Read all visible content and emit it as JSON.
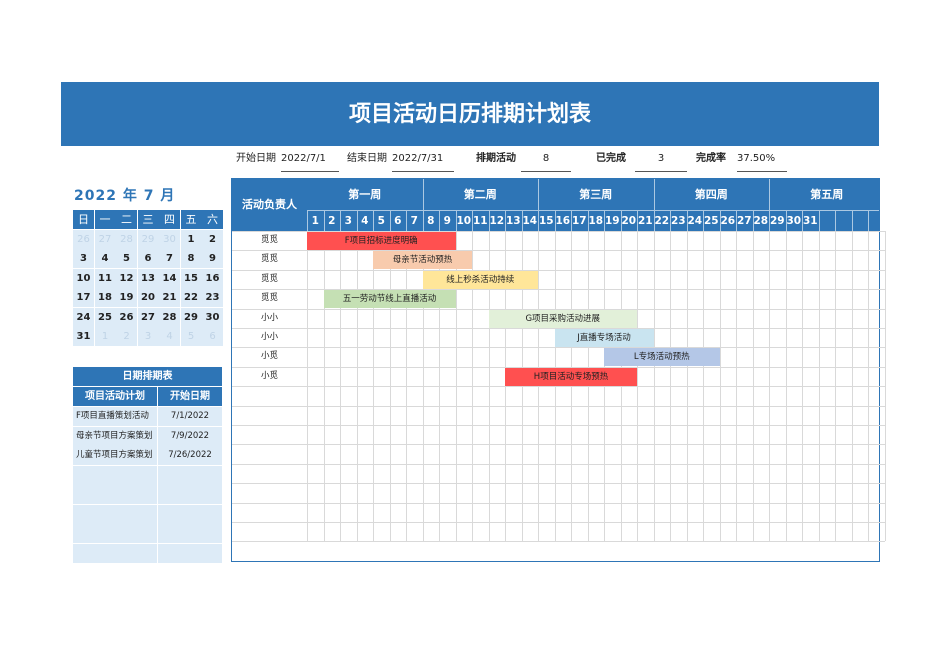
{
  "title": "项目活动日历排期计划表",
  "summary": {
    "start_label": "开始日期",
    "start_value": "2022/7/1",
    "end_label": "结束日期",
    "end_value": "2022/7/31",
    "scheduled_label": "排期活动",
    "scheduled_value": "8",
    "done_label": "已完成",
    "done_value": "3",
    "rate_label": "完成率",
    "rate_value": "37.50%"
  },
  "calendar": {
    "year_label": "2022 年  7  月",
    "weekdays": [
      "日",
      "一",
      "二",
      "三",
      "四",
      "五",
      "六"
    ],
    "weeks": [
      [
        {
          "d": "26",
          "in": false
        },
        {
          "d": "27",
          "in": false
        },
        {
          "d": "28",
          "in": false
        },
        {
          "d": "29",
          "in": false
        },
        {
          "d": "30",
          "in": false
        },
        {
          "d": "1",
          "in": true
        },
        {
          "d": "2",
          "in": true
        }
      ],
      [
        {
          "d": "3",
          "in": true
        },
        {
          "d": "4",
          "in": true
        },
        {
          "d": "5",
          "in": true
        },
        {
          "d": "6",
          "in": true
        },
        {
          "d": "7",
          "in": true
        },
        {
          "d": "8",
          "in": true
        },
        {
          "d": "9",
          "in": true
        }
      ],
      [
        {
          "d": "10",
          "in": true
        },
        {
          "d": "11",
          "in": true
        },
        {
          "d": "12",
          "in": true
        },
        {
          "d": "13",
          "in": true
        },
        {
          "d": "14",
          "in": true
        },
        {
          "d": "15",
          "in": true
        },
        {
          "d": "16",
          "in": true
        }
      ],
      [
        {
          "d": "17",
          "in": true
        },
        {
          "d": "18",
          "in": true
        },
        {
          "d": "19",
          "in": true
        },
        {
          "d": "20",
          "in": true
        },
        {
          "d": "21",
          "in": true
        },
        {
          "d": "22",
          "in": true
        },
        {
          "d": "23",
          "in": true
        }
      ],
      [
        {
          "d": "24",
          "in": true
        },
        {
          "d": "25",
          "in": true
        },
        {
          "d": "26",
          "in": true
        },
        {
          "d": "27",
          "in": true
        },
        {
          "d": "28",
          "in": true
        },
        {
          "d": "29",
          "in": true
        },
        {
          "d": "30",
          "in": true
        }
      ],
      [
        {
          "d": "31",
          "in": true
        },
        {
          "d": "1",
          "in": false
        },
        {
          "d": "2",
          "in": false
        },
        {
          "d": "3",
          "in": false
        },
        {
          "d": "4",
          "in": false
        },
        {
          "d": "5",
          "in": false
        },
        {
          "d": "6",
          "in": false
        }
      ]
    ]
  },
  "schedule_table": {
    "title": "日期排期表",
    "col_plan": "项目活动计划",
    "col_start": "开始日期",
    "rows": [
      {
        "plan": "F项目直播策划活动",
        "start": "7/1/2022"
      },
      {
        "plan": "母亲节项目方案策划",
        "start": "7/9/2022"
      },
      {
        "plan": "儿童节项目方案策划",
        "start": "7/26/2022"
      },
      {
        "plan": "",
        "start": ""
      },
      {
        "plan": "",
        "start": ""
      },
      {
        "plan": "",
        "start": ""
      },
      {
        "plan": "",
        "start": ""
      },
      {
        "plan": "",
        "start": ""
      }
    ]
  },
  "gantt": {
    "owner_header": "活动负责人",
    "weeks": [
      "第一周",
      "第二周",
      "第三周",
      "第四周",
      "第五周"
    ],
    "days": [
      "1",
      "2",
      "3",
      "4",
      "5",
      "6",
      "7",
      "8",
      "9",
      "10",
      "11",
      "12",
      "13",
      "14",
      "15",
      "16",
      "17",
      "18",
      "19",
      "20",
      "21",
      "22",
      "23",
      "24",
      "25",
      "26",
      "27",
      "28",
      "29",
      "30",
      "31"
    ],
    "total_cols": 35,
    "total_rows": 16,
    "activities": [
      {
        "owner": "觅觅",
        "label": "F项目招标进度明确",
        "start": 1,
        "end": 9,
        "color": "#ff5050"
      },
      {
        "owner": "觅觅",
        "label": "母亲节活动预热",
        "start": 5,
        "end": 10,
        "color": "#f8cbad"
      },
      {
        "owner": "觅觅",
        "label": "线上秒杀活动持续",
        "start": 8,
        "end": 14,
        "color": "#ffe699"
      },
      {
        "owner": "觅觅",
        "label": "五一劳动节线上直播活动",
        "start": 2,
        "end": 9,
        "color": "#c5e0b4"
      },
      {
        "owner": "小小",
        "label": "G项目采购活动进展",
        "start": 12,
        "end": 20,
        "color": "#e2f0d9"
      },
      {
        "owner": "小小",
        "label": "J直播专场活动",
        "start": 16,
        "end": 21,
        "color": "#c9e4f0"
      },
      {
        "owner": "小觅",
        "label": "L专场活动预热",
        "start": 19,
        "end": 25,
        "color": "#b4c7e7"
      },
      {
        "owner": "小觅",
        "label": "H项目活动专场预热",
        "start": 13,
        "end": 20,
        "color": "#ff5050"
      }
    ]
  }
}
